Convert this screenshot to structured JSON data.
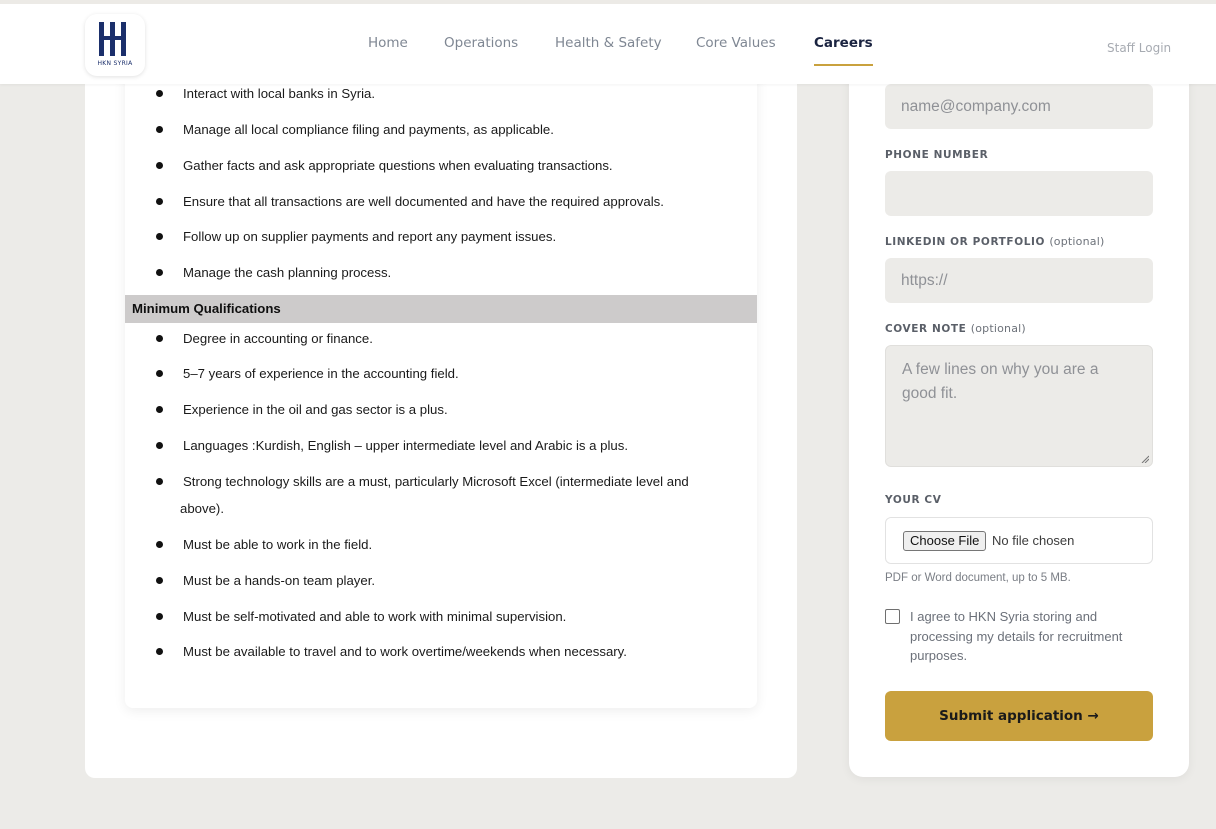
{
  "header": {
    "logo_text": "HKN SYRIA",
    "nav": [
      {
        "label": "Home"
      },
      {
        "label": "Operations"
      },
      {
        "label": "Health & Safety"
      },
      {
        "label": "Core Values"
      },
      {
        "label": "Careers",
        "active": true
      }
    ],
    "staff_login": "Staff Login",
    "accent_color": "#c9a13e",
    "brand_color": "#1b2f6b"
  },
  "job": {
    "responsibilities": [
      "Interact with local banks in Syria.",
      "Manage all local compliance filing and payments, as applicable.",
      "Gather facts and ask appropriate questions when evaluating transactions.",
      "Ensure that all transactions are well documented and have the required approvals.",
      "Follow up on supplier payments and report any payment issues.",
      "Manage the cash planning process."
    ],
    "qualifications_title": "Minimum Qualifications",
    "qualifications": [
      "Degree in accounting or finance.",
      "5–7 years of experience in the accounting field.",
      "Experience in the oil and gas sector is a plus.",
      "Languages :Kurdish, English – upper intermediate level and Arabic is a plus.",
      "Strong technology skills are a must, particularly Microsoft Excel (intermediate level and",
      "above).",
      "Must be able to work in the field.",
      "Must be a hands-on team player.",
      "Must be self-motivated and able to work with minimal supervision.",
      "Must be available to travel and to work overtime/weekends when necessary."
    ]
  },
  "form": {
    "email_placeholder": "name@company.com",
    "phone_label": "PHONE NUMBER",
    "phone_value": "",
    "linkedin_label": "LINKEDIN OR PORTFOLIO",
    "linkedin_optional": "(optional)",
    "linkedin_placeholder": "https://",
    "cover_label": "COVER NOTE",
    "cover_optional": "(optional)",
    "cover_placeholder": "A few lines on why you are a good fit.",
    "cv_label": "YOUR CV",
    "choose_file": "Choose File",
    "no_file": "No file chosen",
    "cv_hint": "PDF or Word document, up to 5 MB.",
    "consent": "I agree to HKN Syria storing and processing my details for recruitment purposes.",
    "consent_checked": false,
    "submit": "Submit application →"
  }
}
